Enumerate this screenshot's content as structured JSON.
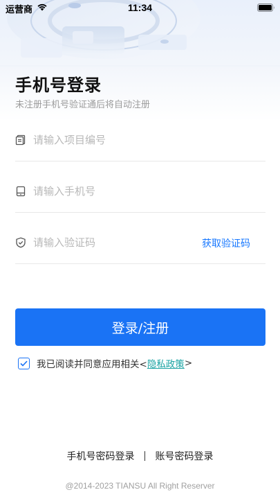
{
  "status_bar": {
    "carrier": "运营商",
    "time": "11:34",
    "wifi_icon": "wifi-icon",
    "battery_icon": "battery-icon"
  },
  "header": {
    "title": "手机号登录",
    "subtitle": "未注册手机号验证通后将自动注册"
  },
  "form": {
    "project_field": {
      "placeholder": "请输入项目编号",
      "value": "",
      "icon": "document-icon"
    },
    "phone_field": {
      "placeholder": "请输入手机号",
      "value": "",
      "icon": "phone-icon"
    },
    "code_field": {
      "placeholder": "请输入验证码",
      "value": "",
      "icon": "shield-icon",
      "get_code_label": "获取验证码"
    },
    "submit_label": "登录/注册"
  },
  "agreement": {
    "checked": true,
    "text": "我已阅读并同意应用相关<",
    "link_label": "隐私政策",
    "suffix": ">"
  },
  "alt_login": {
    "phone_password": "手机号密码登录",
    "account_password": "账号密码登录"
  },
  "footer": {
    "copyright": "@2014-2023 TIANSU All Right Reserver"
  },
  "colors": {
    "primary": "#1a73f5",
    "link": "#1aa3a3",
    "placeholder": "#b8b8b8"
  }
}
